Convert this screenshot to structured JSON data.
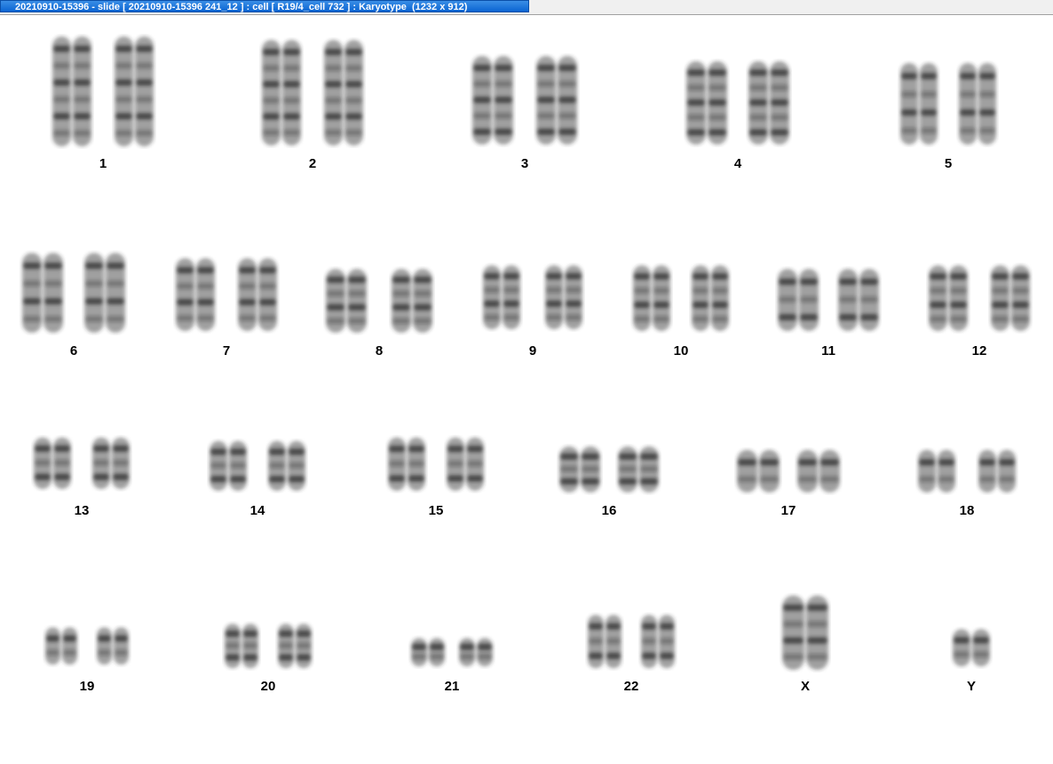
{
  "window": {
    "title": "20210910-15396 - slide [ 20210910-15396 241_12 ] : cell [ R19/4_cell 732 ] : Karyotype  (1232 x 912)"
  },
  "karyotype": {
    "colors": {
      "band": "#2b2b2b",
      "label": "#000000",
      "background": "#ffffff"
    },
    "pairs": [
      {
        "label": "1"
      },
      {
        "label": "2"
      },
      {
        "label": "3"
      },
      {
        "label": "4"
      },
      {
        "label": "5"
      },
      {
        "label": "6"
      },
      {
        "label": "7"
      },
      {
        "label": "8"
      },
      {
        "label": "9"
      },
      {
        "label": "10"
      },
      {
        "label": "11"
      },
      {
        "label": "12"
      },
      {
        "label": "13"
      },
      {
        "label": "14"
      },
      {
        "label": "15"
      },
      {
        "label": "16"
      },
      {
        "label": "17"
      },
      {
        "label": "18"
      },
      {
        "label": "19"
      },
      {
        "label": "20"
      },
      {
        "label": "21"
      },
      {
        "label": "22"
      },
      {
        "label": "X"
      },
      {
        "label": "Y"
      }
    ]
  }
}
